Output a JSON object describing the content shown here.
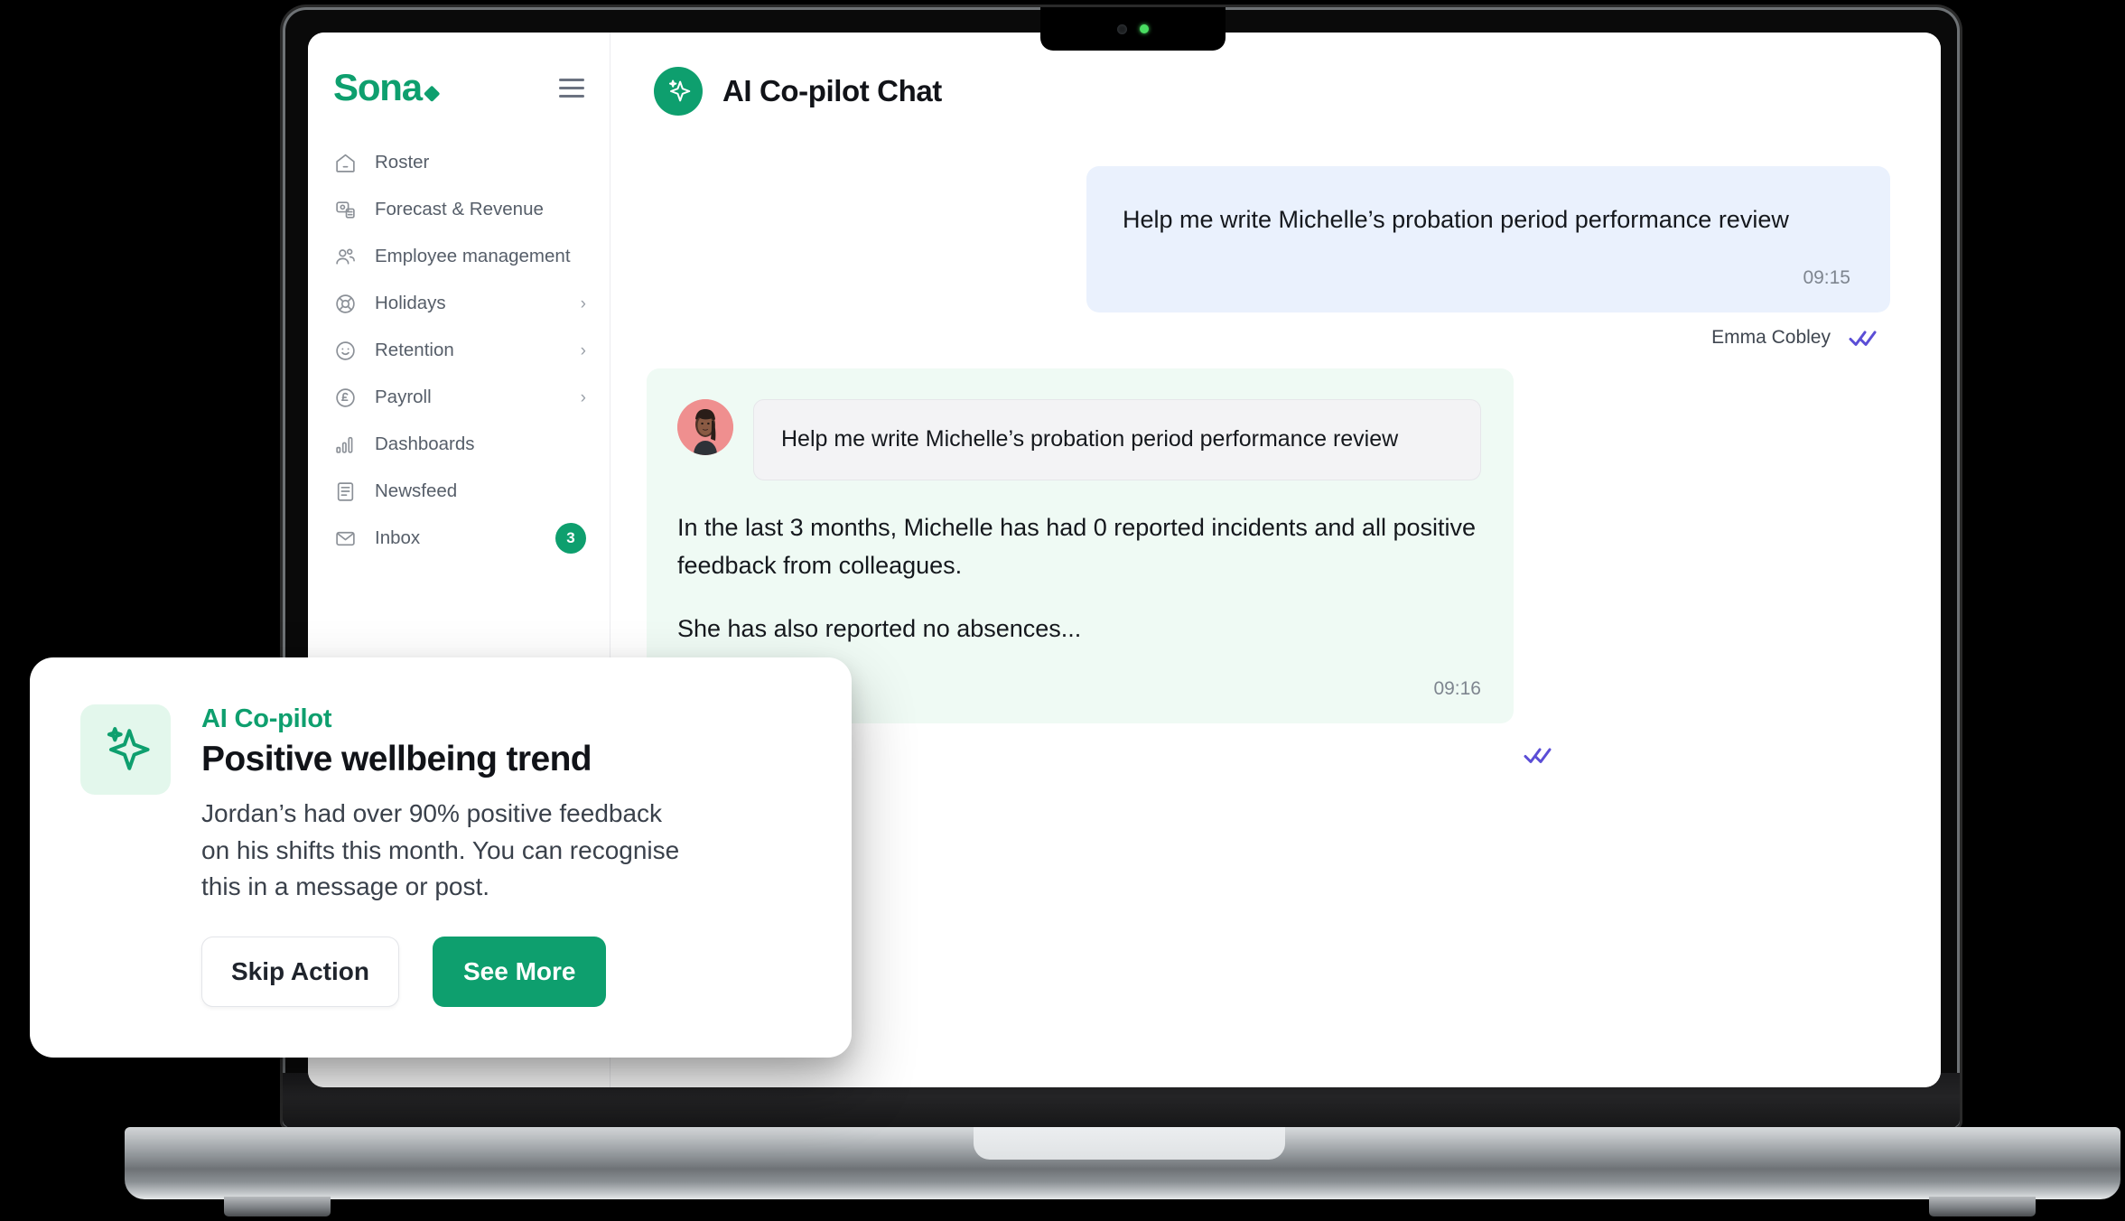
{
  "brand": {
    "name": "Sona",
    "dot": "diamond-dot"
  },
  "sidebar": {
    "menu_icon": "hamburger-icon",
    "items": [
      {
        "label": "Roster",
        "icon": "home-icon",
        "chevron": "",
        "badge": ""
      },
      {
        "label": "Forecast & Revenue",
        "icon": "forecast-icon",
        "chevron": "",
        "badge": ""
      },
      {
        "label": "Employee management",
        "icon": "people-icon",
        "chevron": "",
        "badge": ""
      },
      {
        "label": "Holidays",
        "icon": "lifebuoy-icon",
        "chevron": "›",
        "badge": ""
      },
      {
        "label": "Retention",
        "icon": "smiley-icon",
        "chevron": "›",
        "badge": ""
      },
      {
        "label": "Payroll",
        "icon": "pound-icon",
        "chevron": "›",
        "badge": ""
      },
      {
        "label": "Dashboards",
        "icon": "bar-chart-icon",
        "chevron": "",
        "badge": ""
      },
      {
        "label": "Newsfeed",
        "icon": "document-icon",
        "chevron": "",
        "badge": ""
      },
      {
        "label": "Inbox",
        "icon": "envelope-icon",
        "chevron": "",
        "badge": "3"
      }
    ]
  },
  "header": {
    "title": "AI Co-pilot Chat",
    "avatar_icon": "sparkle-icon"
  },
  "chat": {
    "outgoing": {
      "text": "Help me write Michelle’s probation period performance review",
      "time": "09:15",
      "sender": "Emma Cobley",
      "status_icon": "double-check-icon"
    },
    "incoming": {
      "quoted_text": "Help me write Michelle’s probation period performance review",
      "avatar": "user-photo-avatar",
      "paragraph_1": "In the last 3 months, Michelle has had 0 reported incidents and all positive feedback from colleagues.",
      "paragraph_2": "She has also reported no absences...",
      "time": "09:16",
      "status_icon": "double-check-icon"
    }
  },
  "copilot_card": {
    "icon": "sparkle-icon",
    "eyebrow": "AI Co-pilot",
    "title": "Positive wellbeing trend",
    "body": "Jordan’s had over 90% positive feedback on his shifts this month. You can recognise this in a message or post.",
    "skip_label": "Skip Action",
    "primary_label": "See More"
  },
  "device": {
    "camera_icon": "camera-dot",
    "led_icon": "status-led"
  },
  "colors": {
    "brand_green": "#0e9f6e",
    "outgoing_bubble": "#eaf1fd",
    "incoming_bubble": "#effaf4",
    "quote_bubble": "#f3f3f5",
    "tick_purple": "#5b4ed6",
    "copilot_icon_bg": "#e3f7ec"
  }
}
